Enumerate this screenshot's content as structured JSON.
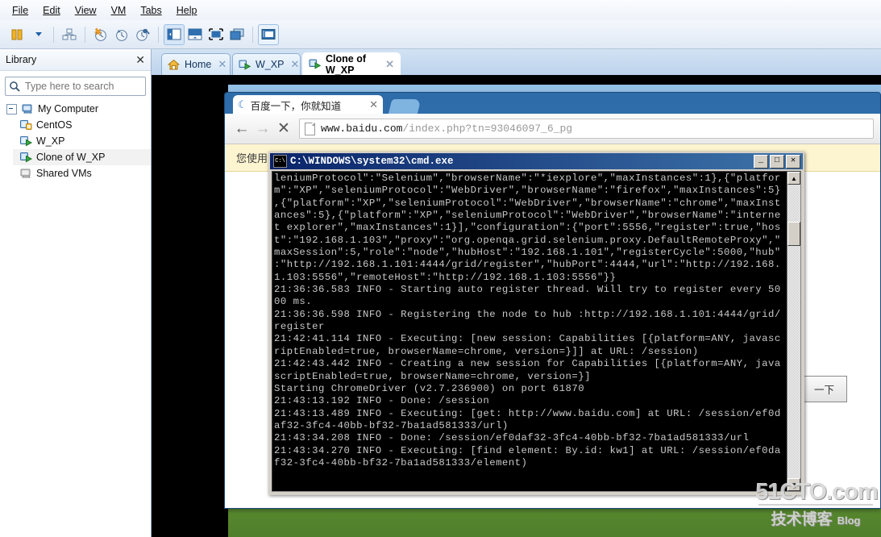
{
  "window": {
    "menu": [
      "File",
      "Edit",
      "View",
      "VM",
      "Tabs",
      "Help"
    ],
    "toolbar_icons": [
      "power-on-vm-icon",
      "dropdown-caret-icon",
      "manage-snapshots-icon",
      "take-snapshot-icon",
      "revert-snapshot-icon",
      "snapshot-manager-icon",
      "show-library-icon",
      "show-thumbnail-bar-icon",
      "enter-fullscreen-icon",
      "unity-mode-icon",
      "console-view-icon"
    ]
  },
  "library": {
    "title": "Library",
    "close_label": "✕",
    "search": {
      "placeholder": "Type here to search",
      "value": "",
      "icon": "search-icon"
    },
    "tree": [
      {
        "label": "My Computer",
        "icon": "computer-icon",
        "level": 0,
        "expanded": true,
        "selected": false
      },
      {
        "label": "CentOS",
        "icon": "vm-suspended-icon",
        "level": 1,
        "expanded": false,
        "selected": false
      },
      {
        "label": "W_XP",
        "icon": "vm-powered-on-icon",
        "level": 1,
        "expanded": false,
        "selected": false
      },
      {
        "label": "Clone of W_XP",
        "icon": "vm-powered-on-icon",
        "level": 1,
        "expanded": false,
        "selected": true
      },
      {
        "label": "Shared VMs",
        "icon": "shared-vms-icon",
        "level": 0,
        "expanded": false,
        "selected": false
      }
    ]
  },
  "tabs": [
    {
      "label": "Home",
      "icon": "home-icon",
      "active": false,
      "close": "✕"
    },
    {
      "label": "W_XP",
      "icon": "vm-powered-on-icon",
      "active": false,
      "close": "✕"
    },
    {
      "label": "Clone of W_XP",
      "icon": "vm-powered-on-icon",
      "active": true,
      "close": "✕"
    }
  ],
  "browser": {
    "tab_title": "百度一下，你就知道",
    "tab_close": "✕",
    "nav": {
      "back": "←",
      "forward": "→",
      "stop": "✕"
    },
    "url_bold": "www.baidu.com",
    "url_rest": "/index.php?tn=93046097_6_pg",
    "notification": "您使用",
    "search_button": "一下"
  },
  "cmd": {
    "title": "C:\\WINDOWS\\system32\\cmd.exe",
    "icon": "console-icon",
    "buttons": {
      "minimize": "_",
      "maximize": "□",
      "close": "✕"
    },
    "scrollbar": {
      "up": "▲",
      "down": "▼"
    },
    "lines": [
      "leniumProtocol\":\"Selenium\",\"browserName\":\"*iexplore\",\"maxInstances\":1},{\"platfor",
      "m\":\"XP\",\"seleniumProtocol\":\"WebDriver\",\"browserName\":\"firefox\",\"maxInstances\":5}",
      ",{\"platform\":\"XP\",\"seleniumProtocol\":\"WebDriver\",\"browserName\":\"chrome\",\"maxInst",
      "ances\":5},{\"platform\":\"XP\",\"seleniumProtocol\":\"WebDriver\",\"browserName\":\"interne",
      "t explorer\",\"maxInstances\":1}],\"configuration\":{\"port\":5556,\"register\":true,\"hos",
      "t\":\"192.168.1.103\",\"proxy\":\"org.openqa.grid.selenium.proxy.DefaultRemoteProxy\",\"",
      "maxSession\":5,\"role\":\"node\",\"hubHost\":\"192.168.1.101\",\"registerCycle\":5000,\"hub\"",
      ":\"http://192.168.1.101:4444/grid/register\",\"hubPort\":4444,\"url\":\"http://192.168.",
      "1.103:5556\",\"remoteHost\":\"http://192.168.1.103:5556\"}}",
      "21:36:36.583 INFO - Starting auto register thread. Will try to register every 50",
      "00 ms.",
      "21:36:36.598 INFO - Registering the node to hub :http://192.168.1.101:4444/grid/",
      "register",
      "21:42:41.114 INFO - Executing: [new session: Capabilities [{platform=ANY, javasc",
      "riptEnabled=true, browserName=chrome, version=}]] at URL: /session)",
      "21:42:43.442 INFO - Creating a new session for Capabilities [{platform=ANY, java",
      "scriptEnabled=true, browserName=chrome, version=}]",
      "Starting ChromeDriver (v2.7.236900) on port 61870",
      "21:43:13.192 INFO - Done: /session",
      "21:43:13.489 INFO - Executing: [get: http://www.baidu.com] at URL: /session/ef0d",
      "af32-3fc4-40bb-bf32-7ba1ad581333/url)",
      "21:43:34.208 INFO - Done: /session/ef0daf32-3fc4-40bb-bf32-7ba1ad581333/url",
      "21:43:34.270 INFO - Executing: [find element: By.id: kw1] at URL: /session/ef0da",
      "f32-3fc4-40bb-bf32-7ba1ad581333/element)"
    ]
  },
  "watermark": {
    "line1": "51CTO.com",
    "line2": "技术博客",
    "line3": "Blog"
  },
  "colors": {
    "accent": "#2d6ca8",
    "titlebar": "#0a246a",
    "console_bg": "#000000",
    "console_fg": "#c8c8c8",
    "notify_bg": "#fdf4d0"
  }
}
